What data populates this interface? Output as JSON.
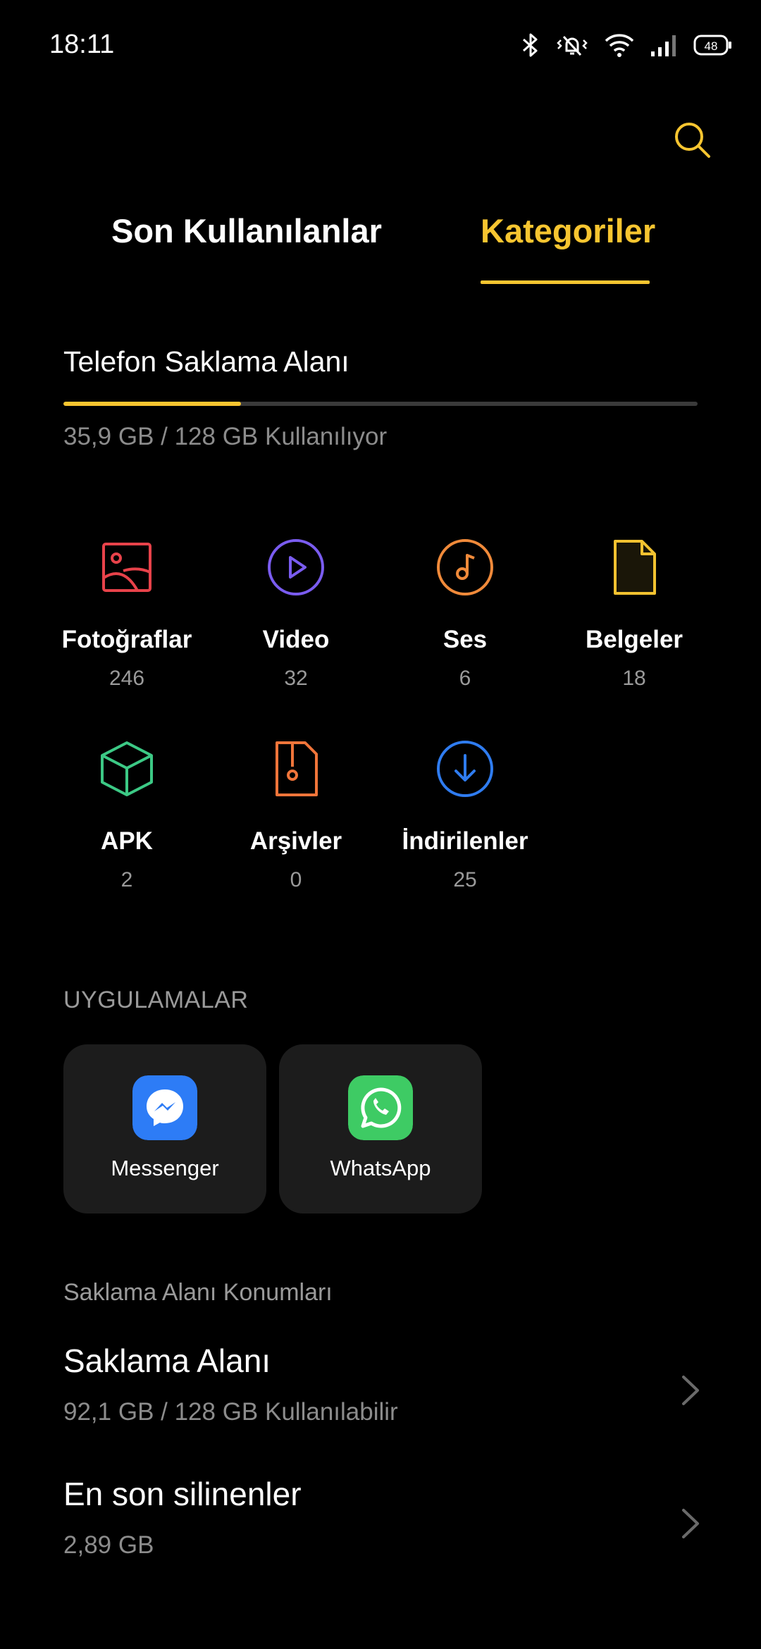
{
  "status_bar": {
    "time": "18:11",
    "battery": "48",
    "icons": [
      "bluetooth-icon",
      "mute-vibrate-icon",
      "wifi-icon",
      "signal-icon",
      "battery-icon"
    ]
  },
  "header": {
    "search_icon": "search-icon",
    "tabs": [
      {
        "label": "Son Kullanılanlar",
        "active": false
      },
      {
        "label": "Kategoriler",
        "active": true
      }
    ]
  },
  "storage": {
    "title": "Telefon Saklama Alanı",
    "usage_text": "35,9 GB / 128 GB Kullanılıyor",
    "used_fraction": 0.28
  },
  "categories": [
    {
      "label": "Fotoğraflar",
      "count": "246",
      "icon": "photos-icon",
      "color": "#e8424a"
    },
    {
      "label": "Video",
      "count": "32",
      "icon": "video-play-icon",
      "color": "#7a5cf0"
    },
    {
      "label": "Ses",
      "count": "6",
      "icon": "audio-note-icon",
      "color": "#f08a3a"
    },
    {
      "label": "Belgeler",
      "count": "18",
      "icon": "document-icon",
      "color": "#f2c230"
    },
    {
      "label": "APK",
      "count": "2",
      "icon": "apk-cube-icon",
      "color": "#3cc985"
    },
    {
      "label": "Arşivler",
      "count": "0",
      "icon": "archive-icon",
      "color": "#f0753a"
    },
    {
      "label": "İndirilenler",
      "count": "25",
      "icon": "download-icon",
      "color": "#2f7cf0"
    }
  ],
  "apps": {
    "heading": "UYGULAMALAR",
    "items": [
      {
        "label": "Messenger",
        "icon": "messenger-icon",
        "color": "#2d7cf6"
      },
      {
        "label": "WhatsApp",
        "icon": "whatsapp-icon",
        "color": "#3ecb64"
      }
    ]
  },
  "locations": {
    "heading": "Saklama Alanı Konumları",
    "items": [
      {
        "title": "Saklama Alanı",
        "subtitle": "92,1 GB / 128 GB Kullanılabilir"
      },
      {
        "title": "En son silinenler",
        "subtitle": "2,89 GB"
      }
    ]
  },
  "colors": {
    "accent": "#f7c530",
    "background": "#000000",
    "card": "#1c1c1c",
    "secondary_text": "#8c8c8c"
  }
}
